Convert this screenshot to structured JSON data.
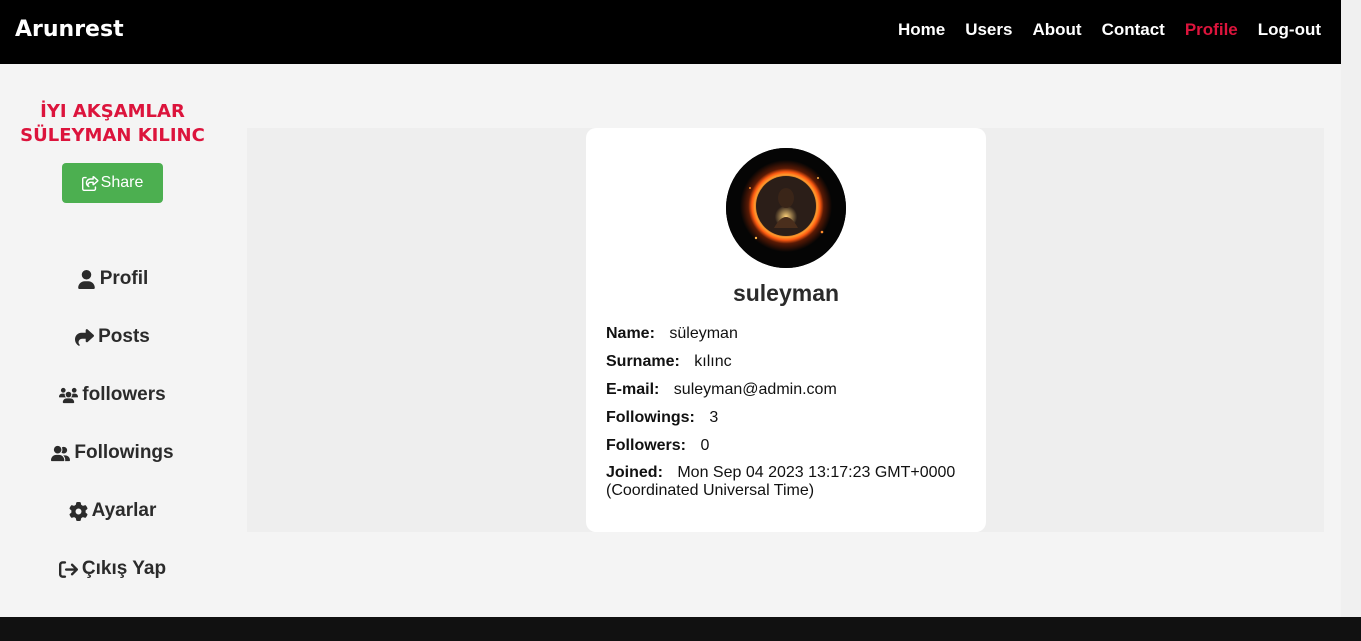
{
  "navbar": {
    "brand": "Arunrest",
    "links": [
      {
        "label": "Home",
        "active": false
      },
      {
        "label": "Users",
        "active": false
      },
      {
        "label": "About",
        "active": false
      },
      {
        "label": "Contact",
        "active": false
      },
      {
        "label": "Profile",
        "active": true
      },
      {
        "label": "Log-out",
        "active": false
      }
    ]
  },
  "sidebar": {
    "greeting_line1": "İYI AKŞAMLAR",
    "greeting_line2": "SÜLEYMAN KILINC",
    "share_label": "Share",
    "menu": [
      {
        "label": "Profil",
        "icon": "user-icon"
      },
      {
        "label": "Posts",
        "icon": "share-arrow-icon"
      },
      {
        "label": "followers",
        "icon": "users-group-icon"
      },
      {
        "label": "Followings",
        "icon": "user-friends-icon"
      },
      {
        "label": "Ayarlar",
        "icon": "gear-icon"
      },
      {
        "label": "Çıkış Yap",
        "icon": "sign-out-icon"
      }
    ]
  },
  "profile": {
    "username": "suleyman",
    "fields": [
      {
        "label": "Name:",
        "value": "süleyman"
      },
      {
        "label": "Surname:",
        "value": "kılınc"
      },
      {
        "label": "E-mail:",
        "value": "suleyman@admin.com"
      },
      {
        "label": "Followings:",
        "value": "3"
      },
      {
        "label": "Followers:",
        "value": "0"
      }
    ],
    "joined_label": "Joined:",
    "joined_value": "Mon Sep 04 2023 13:17:23 GMT+0000 (Coordinated Universal Time)"
  },
  "colors": {
    "accent_red": "#dc143c",
    "share_green": "#4caf50",
    "navbar_bg": "#000000"
  }
}
